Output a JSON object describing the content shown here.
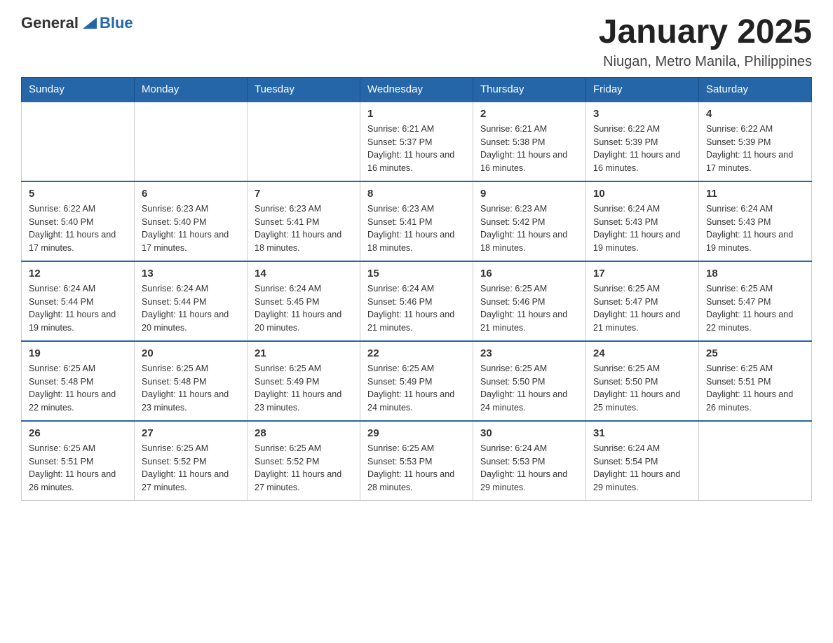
{
  "header": {
    "logo_general": "General",
    "logo_blue": "Blue",
    "month_title": "January 2025",
    "location": "Niugan, Metro Manila, Philippines"
  },
  "weekdays": [
    "Sunday",
    "Monday",
    "Tuesday",
    "Wednesday",
    "Thursday",
    "Friday",
    "Saturday"
  ],
  "weeks": [
    {
      "days": [
        {
          "num": "",
          "info": ""
        },
        {
          "num": "",
          "info": ""
        },
        {
          "num": "",
          "info": ""
        },
        {
          "num": "1",
          "info": "Sunrise: 6:21 AM\nSunset: 5:37 PM\nDaylight: 11 hours and 16 minutes."
        },
        {
          "num": "2",
          "info": "Sunrise: 6:21 AM\nSunset: 5:38 PM\nDaylight: 11 hours and 16 minutes."
        },
        {
          "num": "3",
          "info": "Sunrise: 6:22 AM\nSunset: 5:39 PM\nDaylight: 11 hours and 16 minutes."
        },
        {
          "num": "4",
          "info": "Sunrise: 6:22 AM\nSunset: 5:39 PM\nDaylight: 11 hours and 17 minutes."
        }
      ]
    },
    {
      "days": [
        {
          "num": "5",
          "info": "Sunrise: 6:22 AM\nSunset: 5:40 PM\nDaylight: 11 hours and 17 minutes."
        },
        {
          "num": "6",
          "info": "Sunrise: 6:23 AM\nSunset: 5:40 PM\nDaylight: 11 hours and 17 minutes."
        },
        {
          "num": "7",
          "info": "Sunrise: 6:23 AM\nSunset: 5:41 PM\nDaylight: 11 hours and 18 minutes."
        },
        {
          "num": "8",
          "info": "Sunrise: 6:23 AM\nSunset: 5:41 PM\nDaylight: 11 hours and 18 minutes."
        },
        {
          "num": "9",
          "info": "Sunrise: 6:23 AM\nSunset: 5:42 PM\nDaylight: 11 hours and 18 minutes."
        },
        {
          "num": "10",
          "info": "Sunrise: 6:24 AM\nSunset: 5:43 PM\nDaylight: 11 hours and 19 minutes."
        },
        {
          "num": "11",
          "info": "Sunrise: 6:24 AM\nSunset: 5:43 PM\nDaylight: 11 hours and 19 minutes."
        }
      ]
    },
    {
      "days": [
        {
          "num": "12",
          "info": "Sunrise: 6:24 AM\nSunset: 5:44 PM\nDaylight: 11 hours and 19 minutes."
        },
        {
          "num": "13",
          "info": "Sunrise: 6:24 AM\nSunset: 5:44 PM\nDaylight: 11 hours and 20 minutes."
        },
        {
          "num": "14",
          "info": "Sunrise: 6:24 AM\nSunset: 5:45 PM\nDaylight: 11 hours and 20 minutes."
        },
        {
          "num": "15",
          "info": "Sunrise: 6:24 AM\nSunset: 5:46 PM\nDaylight: 11 hours and 21 minutes."
        },
        {
          "num": "16",
          "info": "Sunrise: 6:25 AM\nSunset: 5:46 PM\nDaylight: 11 hours and 21 minutes."
        },
        {
          "num": "17",
          "info": "Sunrise: 6:25 AM\nSunset: 5:47 PM\nDaylight: 11 hours and 21 minutes."
        },
        {
          "num": "18",
          "info": "Sunrise: 6:25 AM\nSunset: 5:47 PM\nDaylight: 11 hours and 22 minutes."
        }
      ]
    },
    {
      "days": [
        {
          "num": "19",
          "info": "Sunrise: 6:25 AM\nSunset: 5:48 PM\nDaylight: 11 hours and 22 minutes."
        },
        {
          "num": "20",
          "info": "Sunrise: 6:25 AM\nSunset: 5:48 PM\nDaylight: 11 hours and 23 minutes."
        },
        {
          "num": "21",
          "info": "Sunrise: 6:25 AM\nSunset: 5:49 PM\nDaylight: 11 hours and 23 minutes."
        },
        {
          "num": "22",
          "info": "Sunrise: 6:25 AM\nSunset: 5:49 PM\nDaylight: 11 hours and 24 minutes."
        },
        {
          "num": "23",
          "info": "Sunrise: 6:25 AM\nSunset: 5:50 PM\nDaylight: 11 hours and 24 minutes."
        },
        {
          "num": "24",
          "info": "Sunrise: 6:25 AM\nSunset: 5:50 PM\nDaylight: 11 hours and 25 minutes."
        },
        {
          "num": "25",
          "info": "Sunrise: 6:25 AM\nSunset: 5:51 PM\nDaylight: 11 hours and 26 minutes."
        }
      ]
    },
    {
      "days": [
        {
          "num": "26",
          "info": "Sunrise: 6:25 AM\nSunset: 5:51 PM\nDaylight: 11 hours and 26 minutes."
        },
        {
          "num": "27",
          "info": "Sunrise: 6:25 AM\nSunset: 5:52 PM\nDaylight: 11 hours and 27 minutes."
        },
        {
          "num": "28",
          "info": "Sunrise: 6:25 AM\nSunset: 5:52 PM\nDaylight: 11 hours and 27 minutes."
        },
        {
          "num": "29",
          "info": "Sunrise: 6:25 AM\nSunset: 5:53 PM\nDaylight: 11 hours and 28 minutes."
        },
        {
          "num": "30",
          "info": "Sunrise: 6:24 AM\nSunset: 5:53 PM\nDaylight: 11 hours and 29 minutes."
        },
        {
          "num": "31",
          "info": "Sunrise: 6:24 AM\nSunset: 5:54 PM\nDaylight: 11 hours and 29 minutes."
        },
        {
          "num": "",
          "info": ""
        }
      ]
    }
  ]
}
